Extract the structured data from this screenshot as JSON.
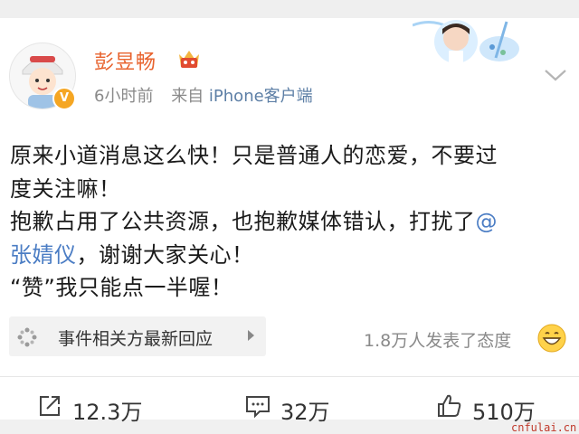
{
  "post": {
    "username": "彭昱畅",
    "time": "6小时前",
    "source_prefix": "来自",
    "source_app": "iPhone客户端",
    "content": {
      "line1": "原来小道消息这么快！只是普通人的恋爱，不要过",
      "line2": "度关注嘛！",
      "line3_pre": "抱歉占用了公共资源，也抱歉媒体错认，打扰了",
      "mention_at": "@",
      "mention_name": "张婧仪",
      "line4_post": "，谢谢大家关心！",
      "line5": "“赞”我只能点一半喔！"
    }
  },
  "event_bar": {
    "label": "事件相关方最新回应"
  },
  "attitude_text": "1.8万人发表了态度",
  "actions": {
    "share_count": "12.3万",
    "comment_count": "32万",
    "like_count": "510万"
  },
  "watermark": "cnfulai.cn",
  "icons": {
    "verified": "verified-badge-icon",
    "vip": "crown-vip-icon",
    "dropdown": "chevron-down-icon",
    "event": "event-spark-icon",
    "emoji": "grinning-emoji-icon",
    "share": "share-icon",
    "comment": "comment-icon",
    "like": "thumbs-up-icon"
  },
  "colors": {
    "username": "#e8632e",
    "link": "#4b7dc4",
    "verified": "#f5a623",
    "muted": "#8a8a8a"
  }
}
